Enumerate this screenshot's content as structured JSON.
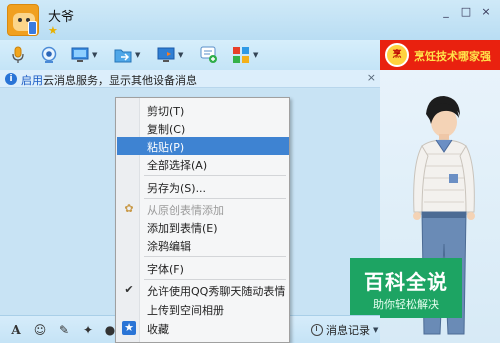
{
  "window": {
    "contact_name": "大爷"
  },
  "info_bar": {
    "link_text": "启用",
    "text": "云消息服务，显示其他设备消息",
    "close": "×"
  },
  "window_buttons": [
    "_",
    "□",
    "×"
  ],
  "ad": {
    "logo_text": "烹",
    "text": "烹饪技术哪家强"
  },
  "watermark": {
    "title": "百科全说",
    "subtitle": "助你轻松解决"
  },
  "bottom_toolbar": {
    "history_label": "消息记录"
  },
  "context_menu": {
    "items": [
      {
        "label": "剪切(T)"
      },
      {
        "label": "复制(C)"
      },
      {
        "label": "粘贴(P)"
      },
      {
        "label": "全部选择(A)"
      },
      {
        "label": "另存为(S)..."
      },
      {
        "label": "从原创表情添加"
      },
      {
        "label": "添加到表情(E)"
      },
      {
        "label": "涂鸦编辑"
      },
      {
        "label": "字体(F)"
      },
      {
        "label": "允许使用QQ秀聊天随动表情"
      },
      {
        "label": "上传到空间相册"
      },
      {
        "label": "收藏"
      }
    ]
  },
  "colors": {
    "menu_highlight": "#3e83d2",
    "info_link": "#1a5bc4",
    "watermark_bg": "#1da463",
    "ad_bg": "#e9210f"
  }
}
